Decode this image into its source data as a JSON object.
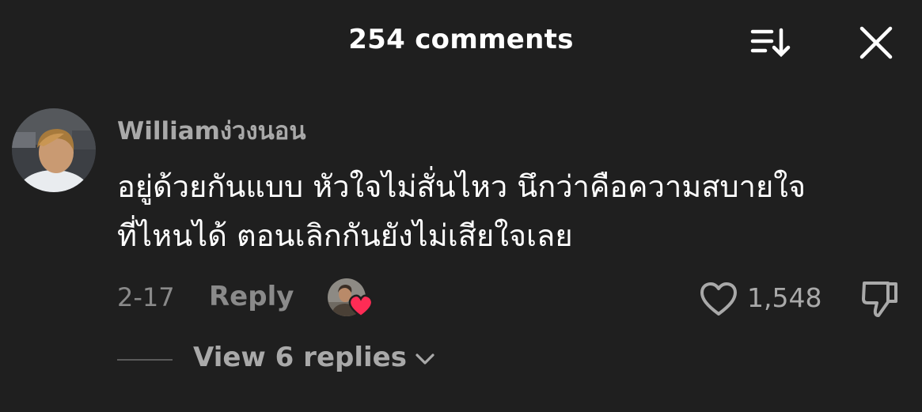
{
  "header": {
    "title": "254 comments"
  },
  "comment": {
    "username": "Williamง่วงนอน",
    "lines": [
      "อยู่ด้วยกันแบบ หัวใจไม่สั่นไหว นึกว่าคือความสบายใจ",
      "ที่ไหนได้ ตอนเลิกกันยังไม่เสียใจเลย"
    ],
    "date": "2-17",
    "reply_label": "Reply",
    "like_count": "1,548",
    "view_replies_label": "View 6 replies",
    "creator_liked": true
  },
  "colors": {
    "background": "#1f1f1f",
    "muted_text": "#a9a9a9",
    "heart_badge": "#fe2c55"
  },
  "icons": {
    "sort": "sort-icon",
    "close": "close-icon",
    "like": "heart-outline-icon",
    "dislike": "thumbs-down-icon",
    "expand": "chevron-down-icon"
  }
}
